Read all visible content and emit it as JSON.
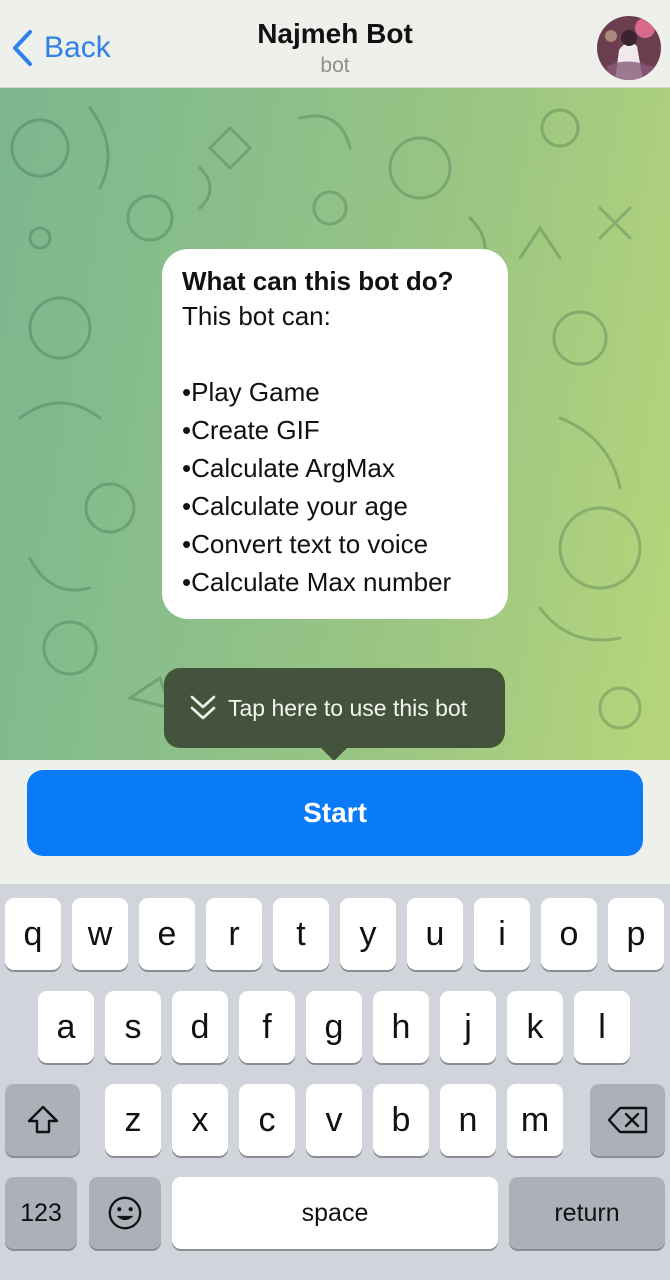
{
  "header": {
    "back_label": "Back",
    "title": "Najmeh Bot",
    "subtitle": "bot"
  },
  "intro": {
    "title": "What can this bot do?",
    "text": "This bot can:",
    "items": [
      "•Play Game",
      "•Create GIF",
      "•Calculate ArgMax",
      "•Calculate your age",
      "•Convert text to voice",
      "•Calculate Max number"
    ]
  },
  "tooltip": {
    "text": "Tap here to use this bot"
  },
  "start_button": {
    "label": "Start"
  },
  "keyboard": {
    "row1": [
      "q",
      "w",
      "e",
      "r",
      "t",
      "y",
      "u",
      "i",
      "o",
      "p"
    ],
    "row2": [
      "a",
      "s",
      "d",
      "f",
      "g",
      "h",
      "j",
      "k",
      "l"
    ],
    "row3": [
      "z",
      "x",
      "c",
      "v",
      "b",
      "n",
      "m"
    ],
    "numbers_label": "123",
    "space_label": "space",
    "return_label": "return"
  },
  "colors": {
    "accent": "#0a7bf8",
    "link": "#2f80e8",
    "tooltip_bg": "#44543c",
    "chat_bg_start": "#7db58e",
    "chat_bg_end": "#b6d67a"
  }
}
